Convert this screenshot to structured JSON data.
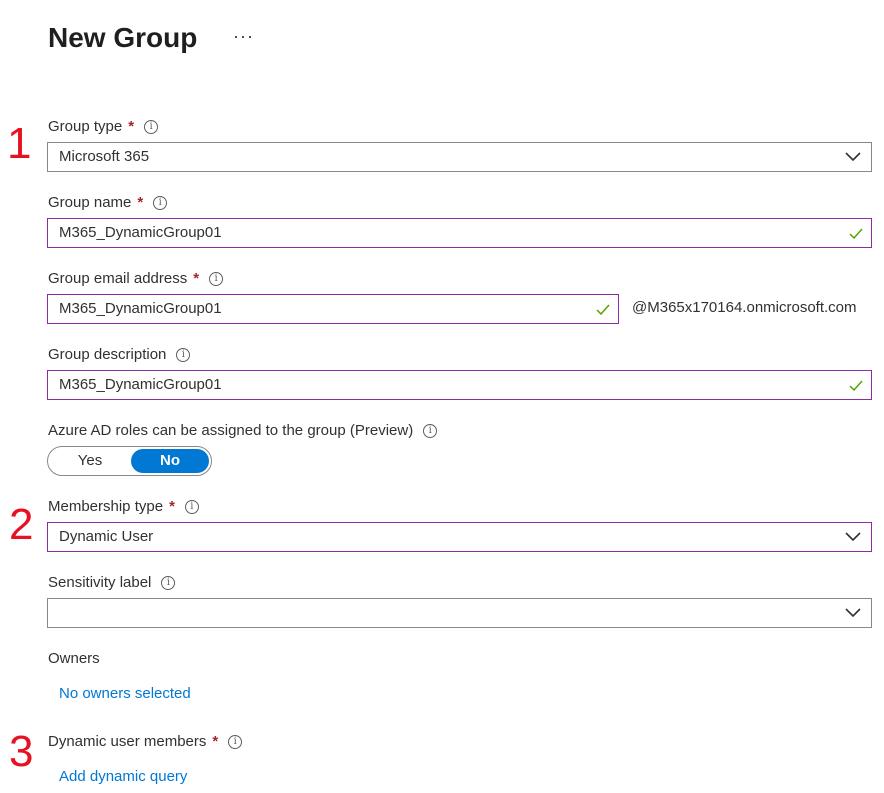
{
  "header": {
    "title": "New Group",
    "more_label": "···"
  },
  "steps": {
    "one": "1",
    "two": "2",
    "three": "3"
  },
  "form": {
    "group_type": {
      "label": "Group type",
      "required_mark": "*",
      "value": "Microsoft 365"
    },
    "group_name": {
      "label": "Group name",
      "required_mark": "*",
      "value": "M365_DynamicGroup01"
    },
    "group_email": {
      "label": "Group email address",
      "required_mark": "*",
      "value": "M365_DynamicGroup01",
      "suffix": "@M365x170164.onmicrosoft.com"
    },
    "group_description": {
      "label": "Group description",
      "value": "M365_DynamicGroup01"
    },
    "azure_ad_roles": {
      "label": "Azure AD roles can be assigned to the group (Preview)",
      "yes_label": "Yes",
      "no_label": "No",
      "selected": "No"
    },
    "membership_type": {
      "label": "Membership type",
      "required_mark": "*",
      "value": "Dynamic User"
    },
    "sensitivity_label": {
      "label": "Sensitivity label",
      "value": ""
    },
    "owners": {
      "label": "Owners",
      "link": "No owners selected"
    },
    "dynamic_members": {
      "label": "Dynamic user members",
      "required_mark": "*",
      "link": "Add dynamic query"
    }
  },
  "colors": {
    "accent": "#0078d4",
    "required": "#a4262c",
    "valid_border": "#8a2da5",
    "valid_check": "#57a300",
    "step_number": "#e81123"
  },
  "icons": {
    "info": "info-icon",
    "dropdown": "chevron-down-icon",
    "valid": "checkmark-icon",
    "more": "more-icon"
  }
}
